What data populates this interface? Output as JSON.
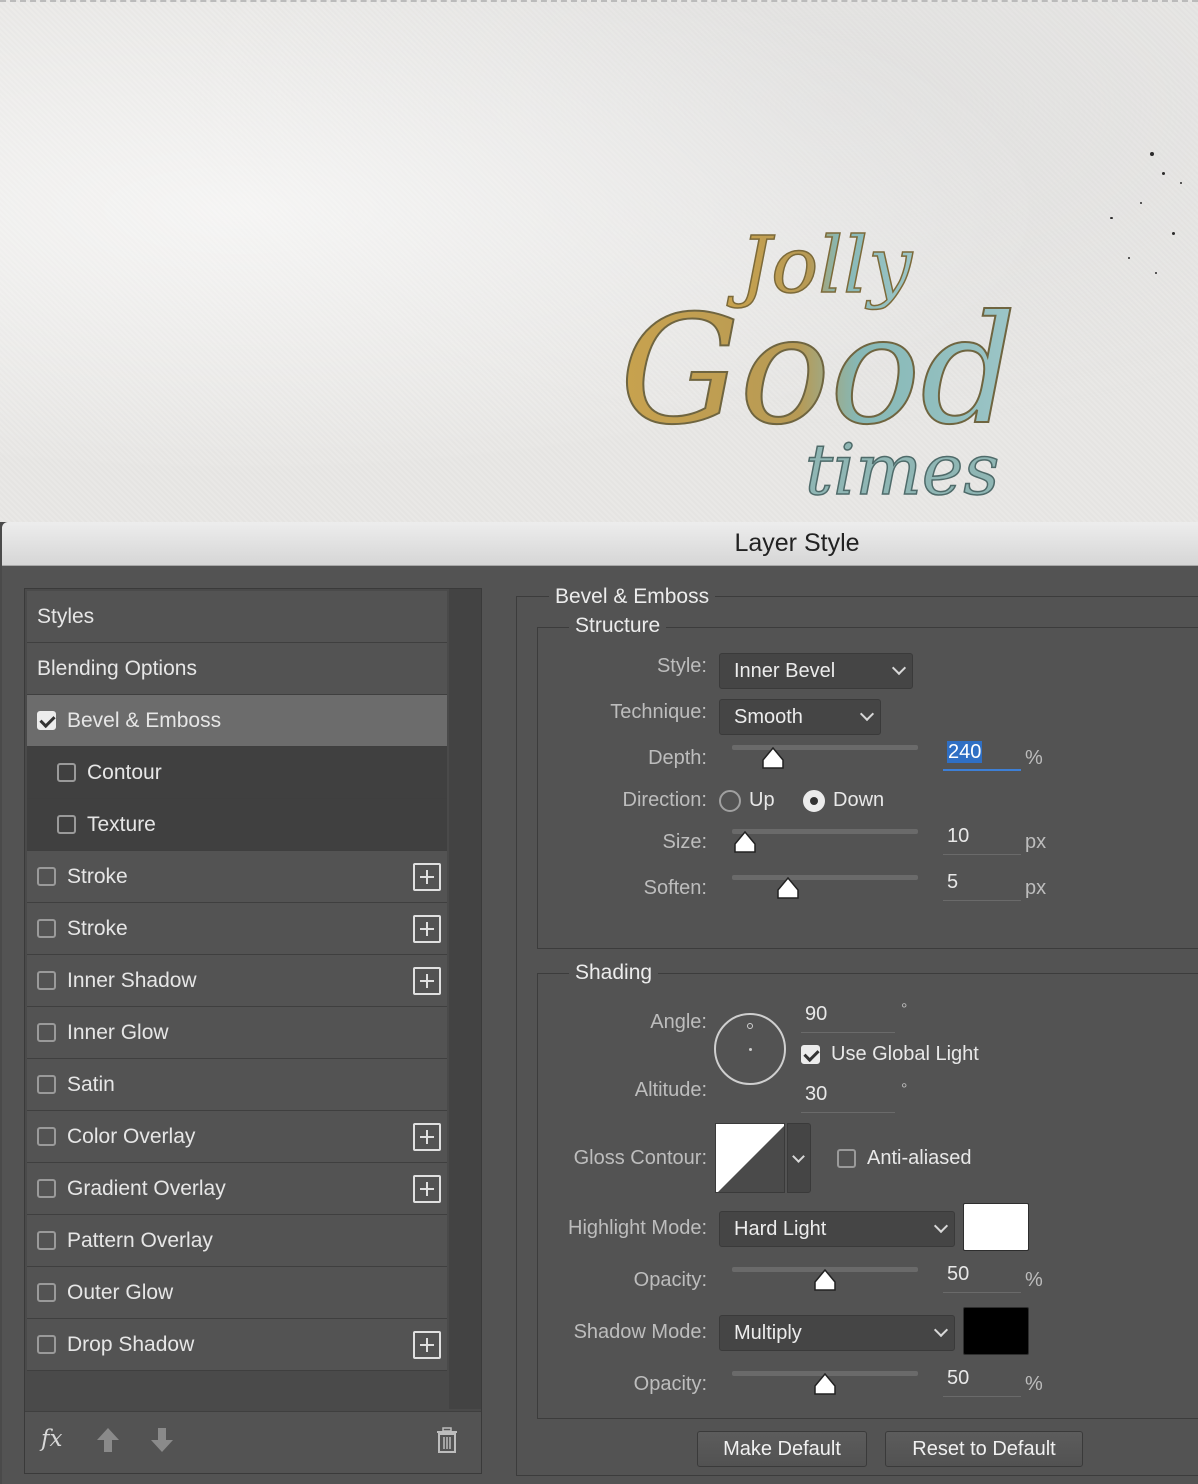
{
  "dialog": {
    "title": "Layer Style"
  },
  "left_list": [
    {
      "label": "Styles",
      "checkbox": false,
      "checked": false,
      "plus": false,
      "selected": false,
      "sub": false
    },
    {
      "label": "Blending Options",
      "checkbox": false,
      "checked": false,
      "plus": false,
      "selected": false,
      "sub": false
    },
    {
      "label": "Bevel & Emboss",
      "checkbox": true,
      "checked": true,
      "plus": false,
      "selected": true,
      "sub": false
    },
    {
      "label": "Contour",
      "checkbox": true,
      "checked": false,
      "plus": false,
      "selected": false,
      "sub": true
    },
    {
      "label": "Texture",
      "checkbox": true,
      "checked": false,
      "plus": false,
      "selected": false,
      "sub": true
    },
    {
      "label": "Stroke",
      "checkbox": true,
      "checked": false,
      "plus": true,
      "selected": false,
      "sub": false
    },
    {
      "label": "Stroke",
      "checkbox": true,
      "checked": false,
      "plus": true,
      "selected": false,
      "sub": false
    },
    {
      "label": "Inner Shadow",
      "checkbox": true,
      "checked": false,
      "plus": true,
      "selected": false,
      "sub": false
    },
    {
      "label": "Inner Glow",
      "checkbox": true,
      "checked": false,
      "plus": false,
      "selected": false,
      "sub": false
    },
    {
      "label": "Satin",
      "checkbox": true,
      "checked": false,
      "plus": false,
      "selected": false,
      "sub": false
    },
    {
      "label": "Color Overlay",
      "checkbox": true,
      "checked": false,
      "plus": true,
      "selected": false,
      "sub": false
    },
    {
      "label": "Gradient Overlay",
      "checkbox": true,
      "checked": false,
      "plus": true,
      "selected": false,
      "sub": false
    },
    {
      "label": "Pattern Overlay",
      "checkbox": true,
      "checked": false,
      "plus": false,
      "selected": false,
      "sub": false
    },
    {
      "label": "Outer Glow",
      "checkbox": true,
      "checked": false,
      "plus": false,
      "selected": false,
      "sub": false
    },
    {
      "label": "Drop Shadow",
      "checkbox": true,
      "checked": false,
      "plus": true,
      "selected": false,
      "sub": false
    }
  ],
  "footer": {
    "fx_label": "fx"
  },
  "bevel": {
    "section_title": "Bevel & Emboss",
    "structure_title": "Structure",
    "style_label": "Style:",
    "style_value": "Inner Bevel",
    "technique_label": "Technique:",
    "technique_value": "Smooth",
    "depth_label": "Depth:",
    "depth_value": "240",
    "depth_unit": "%",
    "depth_level": 0.22,
    "direction_label": "Direction:",
    "dir_up": "Up",
    "dir_down": "Down",
    "direction_selected": "Down",
    "size_label": "Size:",
    "size_value": "10",
    "size_unit": "px",
    "size_level": 0.07,
    "soften_label": "Soften:",
    "soften_value": "5",
    "soften_unit": "px",
    "soften_level": 0.3
  },
  "shading": {
    "title": "Shading",
    "angle_label": "Angle:",
    "angle_value": "90",
    "angle_unit": "°",
    "global_light_label": "Use Global Light",
    "global_light_checked": true,
    "altitude_label": "Altitude:",
    "altitude_value": "30",
    "altitude_unit": "°",
    "gloss_label": "Gloss Contour:",
    "anti_aliased_label": "Anti-aliased",
    "anti_aliased_checked": false,
    "highlight_label": "Highlight Mode:",
    "highlight_value": "Hard Light",
    "highlight_color": "#ffffff",
    "hl_opacity_label": "Opacity:",
    "hl_opacity_value": "50",
    "hl_opacity_unit": "%",
    "hl_opacity_level": 0.5,
    "shadow_label": "Shadow Mode:",
    "shadow_value": "Multiply",
    "shadow_color": "#000000",
    "sh_opacity_label": "Opacity:",
    "sh_opacity_value": "50",
    "sh_opacity_unit": "%",
    "sh_opacity_level": 0.5
  },
  "buttons": {
    "make_default": "Make Default",
    "reset_default": "Reset to Default"
  },
  "icons": [
    "fx-icon",
    "move-up-icon",
    "move-down-icon",
    "trash-icon",
    "chevron-down-icon",
    "add-icon"
  ],
  "colors": {
    "dialog_bg": "#535353",
    "selected_row": "#6c6c6c",
    "accent_blue": "#2f6fc4"
  }
}
